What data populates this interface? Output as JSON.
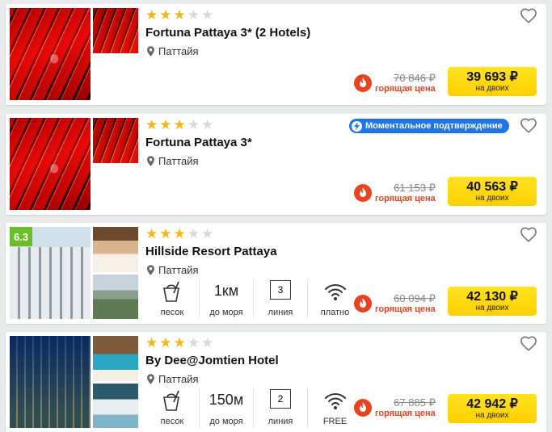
{
  "cards": [
    {
      "name": "Fortuna Pattaya 3* (2 Hotels)",
      "location": "Паттайя",
      "stars": 3,
      "old_price": "70 846 ₽",
      "hot_label": "горящая цена",
      "price": "39 693 ₽",
      "price_note": "на двоих"
    },
    {
      "name": "Fortuna Pattaya 3*",
      "location": "Паттайя",
      "stars": 3,
      "badge": "Моментальное подтверждение",
      "old_price": "61 153 ₽",
      "hot_label": "горящая цена",
      "price": "40 563 ₽",
      "price_note": "на двоих"
    },
    {
      "name": "Hillside Resort Pattaya",
      "location": "Паттайя",
      "stars": 3,
      "rating": "6.3",
      "features": {
        "beach": "песок",
        "distance_value": "1км",
        "distance_label": "до моря",
        "line_value": "3",
        "line_label": "линия",
        "wifi": "платно"
      },
      "old_price": "60 094 ₽",
      "hot_label": "горящая цена",
      "price": "42 130 ₽",
      "price_note": "на двоих"
    },
    {
      "name": "By Dee@Jomtien Hotel",
      "location": "Паттайя",
      "stars": 3,
      "features": {
        "beach": "песок",
        "distance_value": "150м",
        "distance_label": "до моря",
        "line_value": "2",
        "line_label": "линия",
        "wifi": "FREE"
      },
      "old_price": "67 885 ₽",
      "hot_label": "горящая цена",
      "price": "42 942 ₽",
      "price_note": "на двоих"
    }
  ],
  "colors": {
    "star": "#f6b714",
    "hot": "#e9421f",
    "price_button": "#ffd600",
    "badge": "#1e74e8",
    "rating": "#6bbe28"
  }
}
